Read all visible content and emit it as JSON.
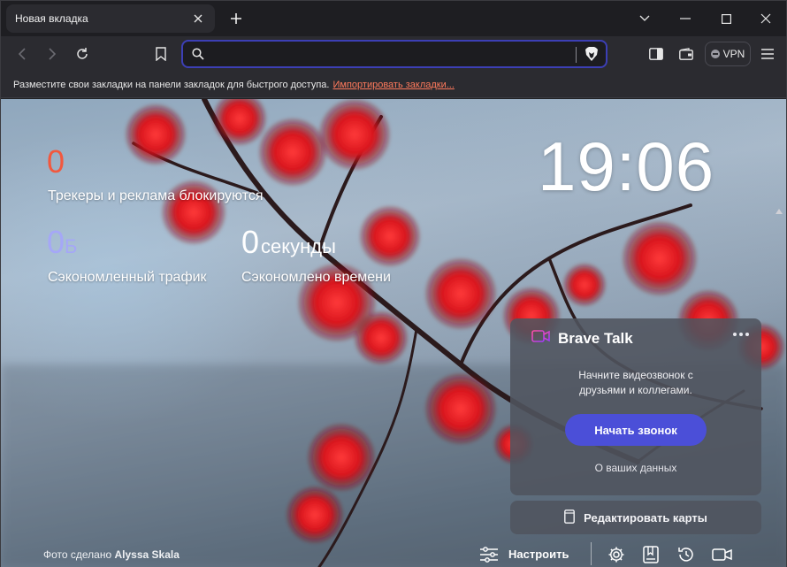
{
  "tab": {
    "title": "Новая вкладка"
  },
  "toolbar": {
    "address_value": "",
    "vpn_label": "VPN"
  },
  "bookmarks_bar": {
    "message": "Разместите свои закладки на панели закладок для быстрого доступа.",
    "import_link": "Импортировать закладки..."
  },
  "stats": {
    "trackers_value": "0",
    "trackers_label": "Трекеры и реклама блокируются",
    "bandwidth_value": "0",
    "bandwidth_unit": "Б",
    "bandwidth_label": "Сэкономленный трафик",
    "time_value": "0",
    "time_unit": "секунды",
    "time_label": "Сэкономлено времени"
  },
  "clock": "19:06",
  "brave_talk": {
    "title": "Brave Talk",
    "description_line1": "Начните видеозвонок с",
    "description_line2": "друзьями и коллегами.",
    "start_button": "Начать звонок",
    "privacy_link": "О ваших данных"
  },
  "edit_cards": "Редактировать карты",
  "footer": {
    "photo_prefix": "Фото сделано",
    "photo_author": "Alyssa Skala",
    "customize_label": "Настроить"
  },
  "colors": {
    "trackers": "#f2583e",
    "bandwidth": "#a5a7f7",
    "accent_button": "#4b4fd8",
    "address_border": "#3c3fb5",
    "import_link": "#ff7a5c"
  },
  "icons": [
    "close-icon",
    "plus-icon",
    "chevron-down-icon",
    "minimize-icon",
    "maximize-icon",
    "back-icon",
    "forward-icon",
    "reload-icon",
    "bookmark-icon",
    "search-icon",
    "brave-lion-icon",
    "sidebar-icon",
    "wallet-icon",
    "menu-icon",
    "video-camera-icon",
    "more-icon",
    "cards-icon",
    "sliders-icon",
    "gear-icon",
    "reading-list-icon",
    "history-icon",
    "brave-talk-icon"
  ]
}
